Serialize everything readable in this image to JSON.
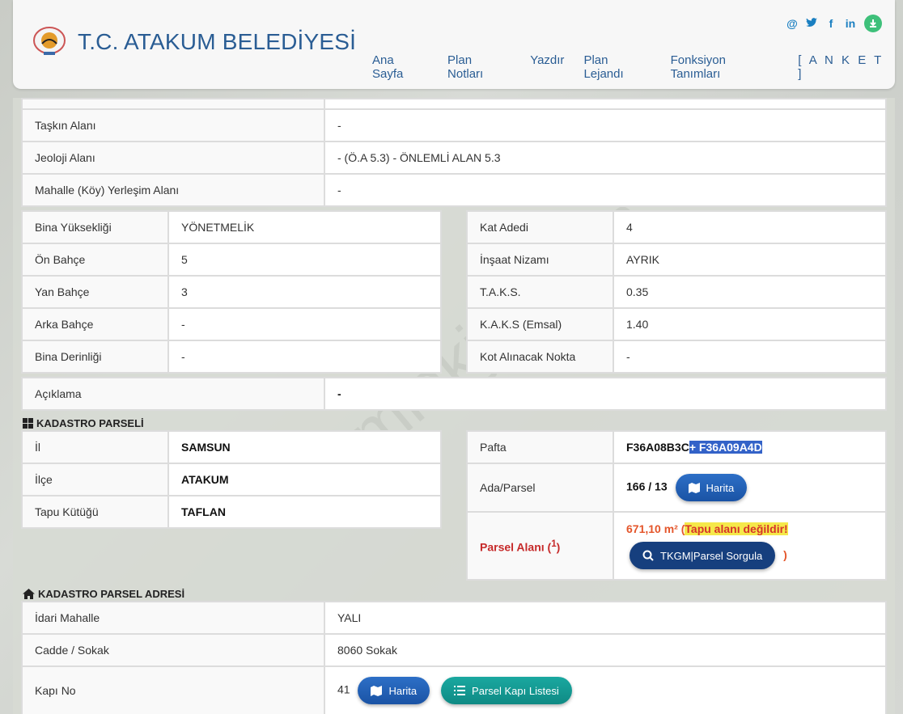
{
  "header": {
    "title": "T.C. ATAKUM BELEDİYESİ",
    "nav": [
      "Ana Sayfa",
      "Plan Notları",
      "Yazdır",
      "Plan Lejandı",
      "Fonksiyon Tanımları",
      "[ A N K E T ]"
    ],
    "social": [
      "@",
      "twitter",
      "f",
      "in",
      "download"
    ]
  },
  "info_rows": [
    {
      "label": "Taşkın Alanı",
      "value": "-"
    },
    {
      "label": "Jeoloji Alanı",
      "value": "- (Ö.A 5.3) - ÖNLEMLİ ALAN 5.3"
    },
    {
      "label": "Mahalle (Köy) Yerleşim Alanı",
      "value": "-"
    }
  ],
  "build_left": [
    {
      "label": "Bina Yüksekliği",
      "value": "YÖNETMELİK"
    },
    {
      "label": "Ön Bahçe",
      "value": "5"
    },
    {
      "label": "Yan Bahçe",
      "value": "3"
    },
    {
      "label": "Arka Bahçe",
      "value": "-"
    },
    {
      "label": "Bina Derinliği",
      "value": "-"
    }
  ],
  "build_right": [
    {
      "label": "Kat Adedi",
      "value": "4"
    },
    {
      "label": "İnşaat Nizamı",
      "value": "AYRIK"
    },
    {
      "label": "T.A.K.S.",
      "value": "0.35"
    },
    {
      "label": "K.A.K.S (Emsal)",
      "value": "1.40"
    },
    {
      "label": "Kot Alınacak Nokta",
      "value": "-"
    }
  ],
  "aciklama": {
    "label": "Açıklama",
    "value": "-"
  },
  "kadastro": {
    "title": "KADASTRO PARSELİ",
    "left": [
      {
        "label": "İl",
        "value": "SAMSUN"
      },
      {
        "label": "İlçe",
        "value": "ATAKUM"
      },
      {
        "label": "Tapu Kütüğü",
        "value": "TAFLAN"
      }
    ],
    "pafta_label": "Pafta",
    "pafta_value": "F36A08B3C",
    "pafta_extra": "+ F36A09A4D",
    "ada_label": "Ada/Parsel",
    "ada_value": "166 / 13",
    "harita": "Harita",
    "parsel_alani_label": "Parsel Alanı (",
    "parsel_alani_sup": "1",
    "parsel_alani_close": ")",
    "area_value": "671,10 m²",
    "area_open": " (",
    "area_note": "Tapu alanı değildir!",
    "tkgm_button": "TKGM|Parsel Sorgula",
    "area_close": ")"
  },
  "adres": {
    "title": "KADASTRO PARSEL ADRESİ",
    "rows": [
      {
        "label": "İdari Mahalle",
        "value": "YALI"
      },
      {
        "label": "Cadde / Sokak",
        "value": "8060 Sokak"
      }
    ],
    "kapi_label": "Kapı No",
    "kapi_value": "41",
    "harita": "Harita",
    "liste": "Parsel Kapı Listesi"
  },
  "watermark": "emlakjet.com"
}
